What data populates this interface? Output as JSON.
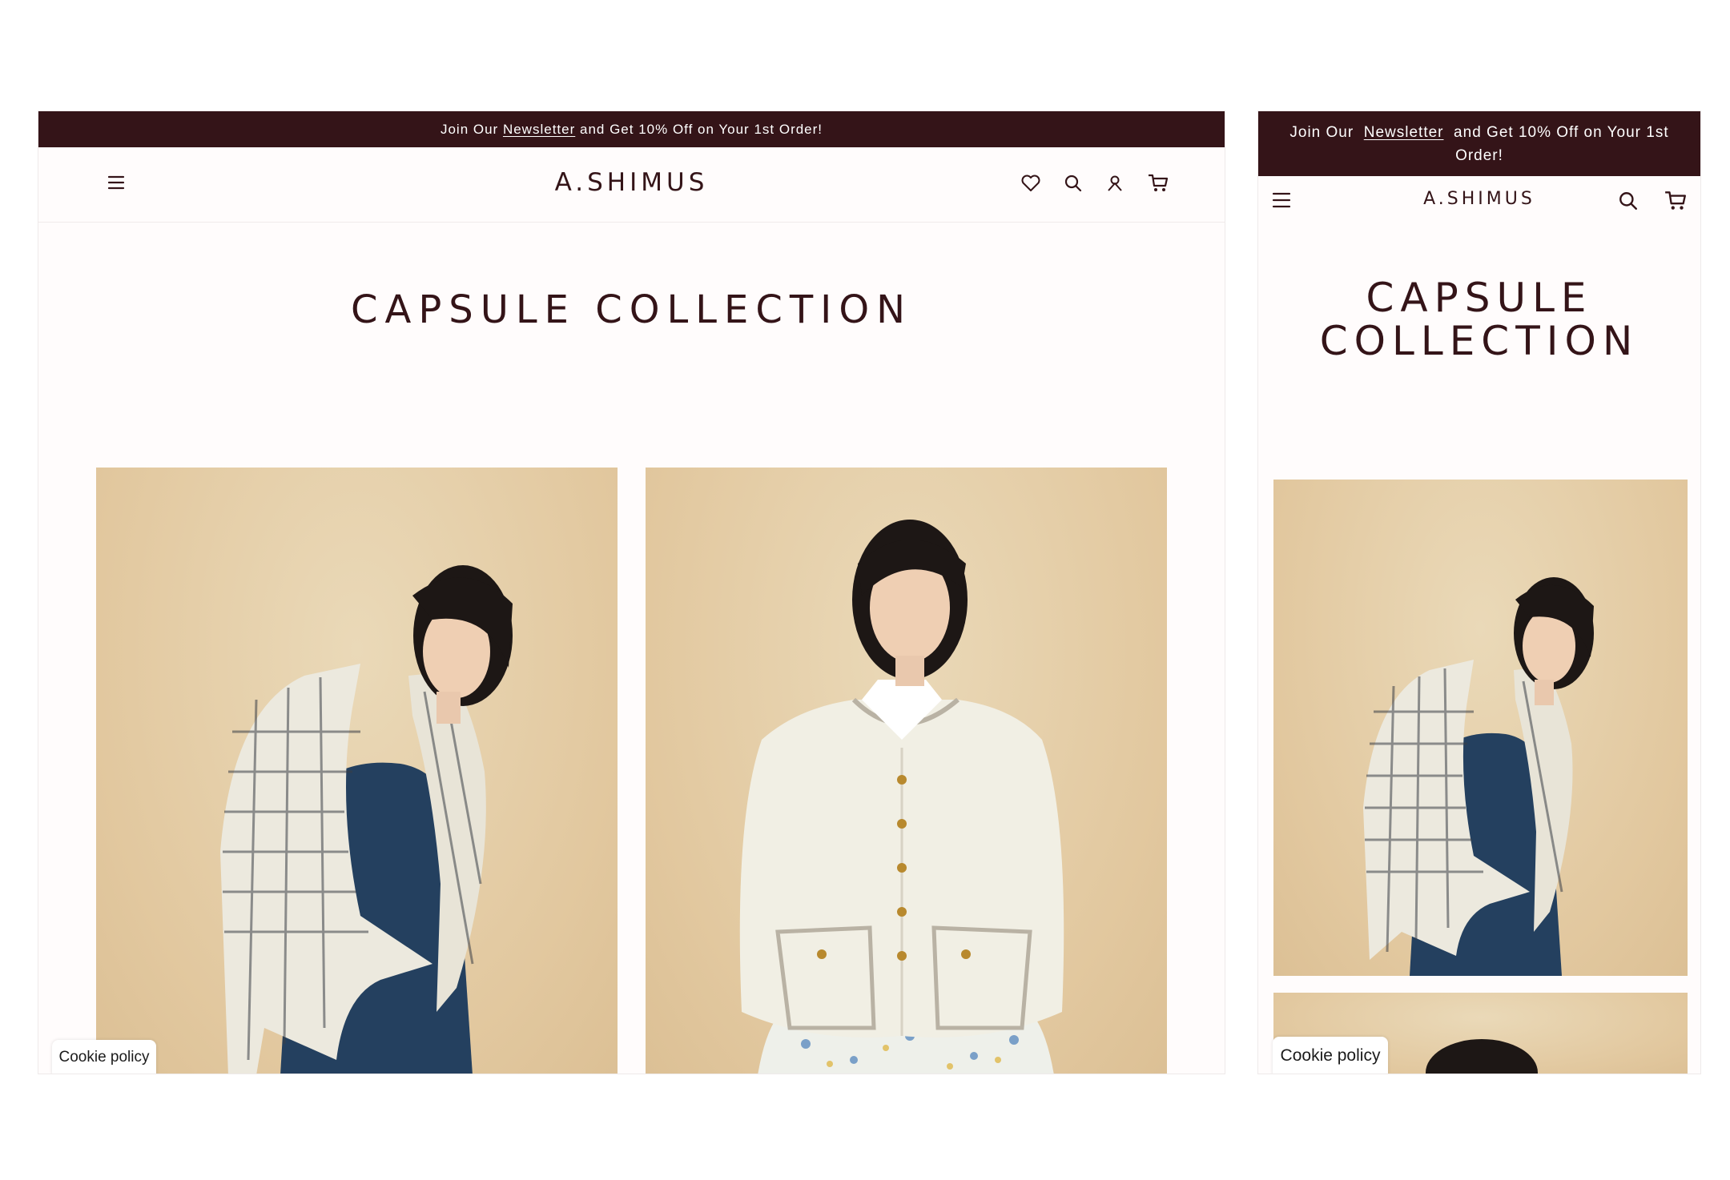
{
  "announcement": {
    "prefix": "Join Our ",
    "link": "Newsletter",
    "suffix": " and Get 10% Off on Your 1st Order!"
  },
  "brand": {
    "logo": "A.SHIMUS"
  },
  "page": {
    "title": "CAPSULE COLLECTION"
  },
  "cookie": {
    "label": "Cookie policy"
  },
  "icons": {
    "menu": "hamburger-menu-icon",
    "wishlist": "heart-icon",
    "search": "search-icon",
    "account": "user-icon",
    "cart": "cart-icon"
  },
  "colors": {
    "brand_dark": "#341418",
    "photo_background": "#e2c89f",
    "page_background": "#fffcfc"
  }
}
